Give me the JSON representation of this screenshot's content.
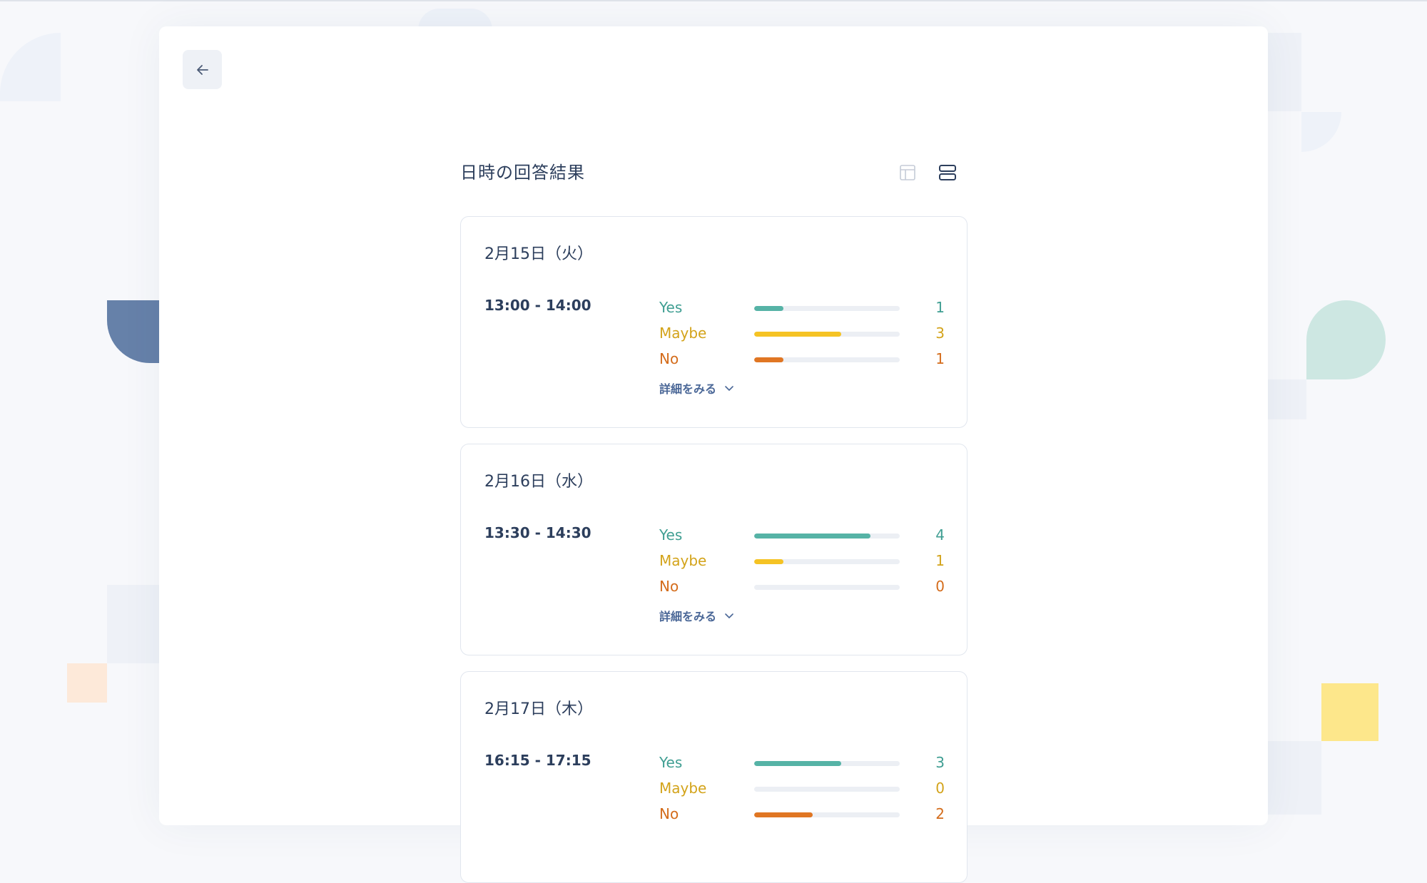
{
  "page": {
    "title": "日時の回答結果",
    "details_label": "詳細をみる"
  },
  "legend": {
    "yes": "Yes",
    "maybe": "Maybe",
    "no": "No"
  },
  "colors": {
    "yes": "#56b3a6",
    "maybe": "#f5c324",
    "no": "#e07623",
    "text": "#2c3e5c"
  },
  "scale_max": 5,
  "cards": [
    {
      "date": "2月15日（火）",
      "time": "13:00 - 14:00",
      "yes": 1,
      "maybe": 3,
      "no": 1
    },
    {
      "date": "2月16日（水）",
      "time": "13:30 - 14:30",
      "yes": 4,
      "maybe": 1,
      "no": 0
    },
    {
      "date": "2月17日（木）",
      "time": "16:15 - 17:15",
      "yes": 3,
      "maybe": 0,
      "no": 2
    }
  ],
  "icons": {
    "back": "arrow-left-icon",
    "grid_view": "grid-view-icon",
    "list_view": "list-view-icon",
    "expand": "chevron-down-icon"
  }
}
